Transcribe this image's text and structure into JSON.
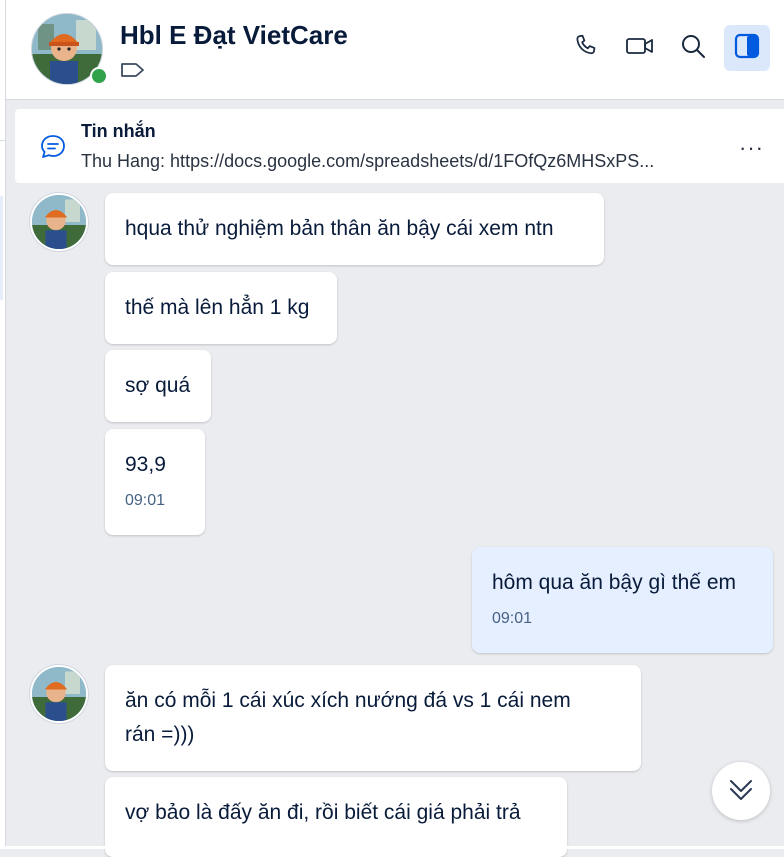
{
  "header": {
    "title": "Hbl E Đạt VietCare",
    "status": "online"
  },
  "pinned": {
    "title": "Tin nhắn",
    "preview": "Thu Hang: https://docs.google.com/spreadsheets/d/1FOfQz6MHSxPS..."
  },
  "messages": [
    {
      "sender": "other",
      "text": "hqua thử nghiệm bản thân ăn bậy cái xem ntn"
    },
    {
      "sender": "other",
      "text": "thế mà lên hẳn 1 kg"
    },
    {
      "sender": "other",
      "text": "sợ quá"
    },
    {
      "sender": "other",
      "text": "93,9",
      "time": "09:01"
    },
    {
      "sender": "me",
      "text": "hôm qua ăn bậy gì thế em",
      "time": "09:01"
    },
    {
      "sender": "other",
      "text_line1": "ăn có mỗi 1 cái xúc xích nướng đá vs 1 cái nem",
      "text_line2": "rán =)))"
    },
    {
      "sender": "other",
      "text": "vợ bảo là đấy ăn đi, rồi biết cái giá phải trả"
    }
  ],
  "colors": {
    "accent": "#005ae0",
    "online": "#30a24a",
    "my_bubble": "#e5efff",
    "background": "#ebecf0"
  },
  "icons": [
    "phone-icon",
    "video-call-icon",
    "search-icon",
    "sidebar-toggle-icon",
    "tag-icon",
    "message-icon",
    "more-icon",
    "scroll-down-icon"
  ]
}
